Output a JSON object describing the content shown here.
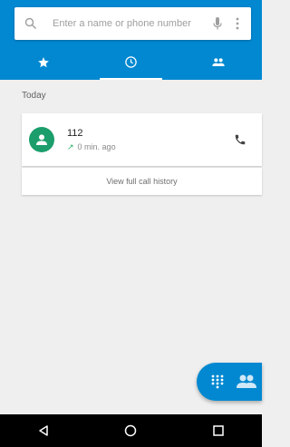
{
  "search": {
    "placeholder": "Enter a name or phone number"
  },
  "tabs": [
    {
      "icon": "star-icon",
      "active": false
    },
    {
      "icon": "clock-icon",
      "active": true
    },
    {
      "icon": "contacts-group-icon",
      "active": false
    }
  ],
  "recents": {
    "section_header": "Today",
    "calls": [
      {
        "number": "112",
        "time": "0 min. ago",
        "type": "outgoing"
      }
    ],
    "history_button": "View full call history"
  },
  "colors": {
    "primary": "#0288d1",
    "avatar": "#1b9e6b",
    "outgoing_arrow": "#2eaf6a"
  }
}
